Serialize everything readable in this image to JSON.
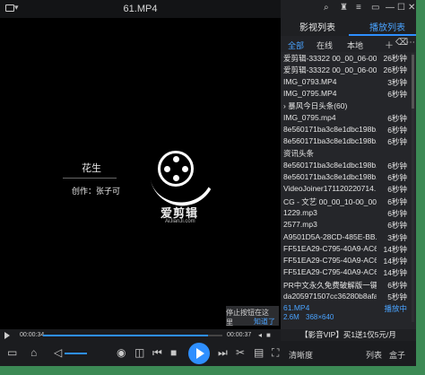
{
  "window": {
    "title": "61.MP4"
  },
  "video": {
    "side_title": "花生",
    "side_author": "创作：张子可",
    "brand": "爱剪辑",
    "brand_url": "AiJianJi.com",
    "tip_line1": "停止按钮在这里",
    "tip_line2": "知道了"
  },
  "seek": {
    "current": "00:00:34",
    "total": "00:00:37",
    "progress": 0.92
  },
  "controls": {
    "clarity_label": "清晰度",
    "list_label": "列表",
    "box_label": "盒子"
  },
  "panel": {
    "tab1": "影视列表",
    "tab2": "播放列表",
    "sub_all": "全部",
    "sub_online": "在线",
    "sub_local": "本地",
    "items": [
      {
        "name": "爱剪辑-33322 00_00_06-00_...",
        "dur": "26秒钟"
      },
      {
        "name": "爱剪辑-33322 00_00_06-00_...",
        "dur": "26秒钟"
      },
      {
        "name": "IMG_0793.MP4",
        "dur": "3秒钟"
      },
      {
        "name": "IMG_0795.MP4",
        "dur": "6秒钟"
      },
      {
        "name": "› 暴风今日头条(60)",
        "dur": ""
      },
      {
        "name": "IMG_0795.mp4",
        "dur": "6秒钟"
      },
      {
        "name": "8e560171ba3c8e1dbc198b...",
        "dur": "6秒钟"
      },
      {
        "name": "8e560171ba3c8e1dbc198b...",
        "dur": "6秒钟"
      },
      {
        "name": "资讯头条",
        "dur": ""
      },
      {
        "name": "8e560171ba3c8e1dbc198b...",
        "dur": "6秒钟"
      },
      {
        "name": "8e560171ba3c8e1dbc198b...",
        "dur": "6秒钟"
      },
      {
        "name": "VideoJoiner171120220714...",
        "dur": "6秒钟"
      },
      {
        "name": "CG - 文艺 00_00_10-00_00_2...",
        "dur": "6秒钟"
      },
      {
        "name": "1229.mp3",
        "dur": "6秒钟"
      },
      {
        "name": "2577.mp3",
        "dur": "6秒钟"
      },
      {
        "name": "A9501D5A-28CD-485E-BB...",
        "dur": "3秒钟"
      },
      {
        "name": "FF51EA29-C795-40A9-AC6...",
        "dur": "14秒钟"
      },
      {
        "name": "FF51EA29-C795-40A9-AC6...",
        "dur": "14秒钟"
      },
      {
        "name": "FF51EA29-C795-40A9-AC6...",
        "dur": "14秒钟"
      },
      {
        "name": "PR中文永久免费破解版一键...",
        "dur": "6秒钟"
      },
      {
        "name": "da205971507cc36280b8afa...",
        "dur": "5秒钟"
      },
      {
        "name": "61.MP4",
        "dur": "播放中"
      }
    ],
    "meta_size": "2.6M",
    "meta_res": "368×640",
    "promo": "【影音VIP】买1送1仅5元/月"
  },
  "colors": {
    "accent": "#2e8fff",
    "bg": "#1b1c1f",
    "desktop": "#3c8a55"
  }
}
